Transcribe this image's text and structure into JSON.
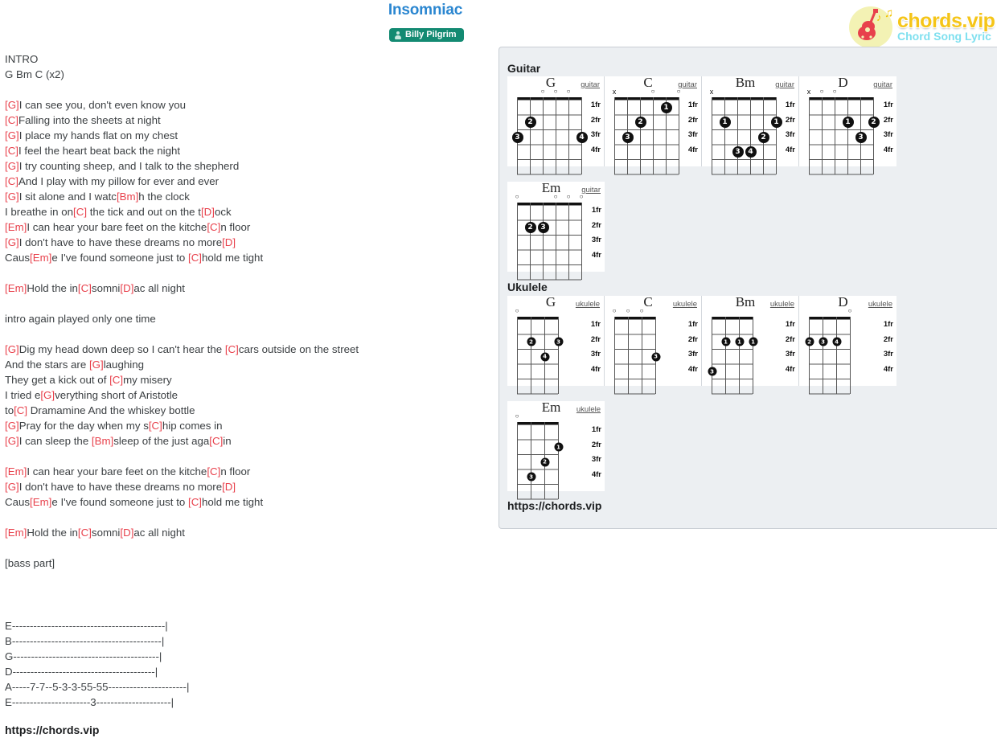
{
  "header": {
    "title": "Insomniac",
    "artist": "Billy Pilgrim",
    "person_icon": "person-icon"
  },
  "logo": {
    "brand": "chords.vip",
    "tagline": "Chord Song Lyric",
    "guitar_icon": "guitar-icon",
    "music_note_icon": "music-note-icon"
  },
  "colors": {
    "title": "#2a86d0",
    "badge_bg": "#138a72",
    "chord": "#e8414c",
    "panel_bg": "#eceff2",
    "logo_yellow": "#f5c518",
    "logo_cyan": "#7fe0ef"
  },
  "lyrics_lines": [
    [
      {
        "t": "INTRO",
        "c": false
      }
    ],
    [
      {
        "t": "G Bm C (x2)",
        "c": false
      }
    ],
    [],
    [
      {
        "t": "[G]",
        "c": true
      },
      {
        "t": "I can see you, don't even know you",
        "c": false
      }
    ],
    [
      {
        "t": "[C]",
        "c": true
      },
      {
        "t": "Falling into the sheets at night",
        "c": false
      }
    ],
    [
      {
        "t": "[G]",
        "c": true
      },
      {
        "t": "I place my hands flat on my chest",
        "c": false
      }
    ],
    [
      {
        "t": "[C]",
        "c": true
      },
      {
        "t": "I feel the heart beat back the night",
        "c": false
      }
    ],
    [
      {
        "t": "[G]",
        "c": true
      },
      {
        "t": "I try counting sheep, and I talk to the shepherd",
        "c": false
      }
    ],
    [
      {
        "t": "[C]",
        "c": true
      },
      {
        "t": "And I play with my pillow for ever and ever",
        "c": false
      }
    ],
    [
      {
        "t": "[G]",
        "c": true
      },
      {
        "t": "I sit alone and I watc",
        "c": false
      },
      {
        "t": "[Bm]",
        "c": true
      },
      {
        "t": "h the clock",
        "c": false
      }
    ],
    [
      {
        "t": "I breathe in on",
        "c": false
      },
      {
        "t": "[C]",
        "c": true
      },
      {
        "t": " the tick and out on the t",
        "c": false
      },
      {
        "t": "[D]",
        "c": true
      },
      {
        "t": "ock",
        "c": false
      }
    ],
    [
      {
        "t": "[Em]",
        "c": true
      },
      {
        "t": "I can hear your bare feet on the kitche",
        "c": false
      },
      {
        "t": "[C]",
        "c": true
      },
      {
        "t": "n floor",
        "c": false
      }
    ],
    [
      {
        "t": "[G]",
        "c": true
      },
      {
        "t": "I don't have to have these dreams no more",
        "c": false
      },
      {
        "t": "[D]",
        "c": true
      }
    ],
    [
      {
        "t": "Caus",
        "c": false
      },
      {
        "t": "[Em]",
        "c": true
      },
      {
        "t": "e I've found someone just to ",
        "c": false
      },
      {
        "t": "[C]",
        "c": true
      },
      {
        "t": "hold me tight",
        "c": false
      }
    ],
    [],
    [
      {
        "t": "[Em]",
        "c": true
      },
      {
        "t": "Hold the in",
        "c": false
      },
      {
        "t": "[C]",
        "c": true
      },
      {
        "t": "somni",
        "c": false
      },
      {
        "t": "[D]",
        "c": true
      },
      {
        "t": "ac all night",
        "c": false
      }
    ],
    [],
    [
      {
        "t": "intro again played only one time",
        "c": false
      }
    ],
    [],
    [
      {
        "t": "[G]",
        "c": true
      },
      {
        "t": "Dig my head down deep so I can't hear the ",
        "c": false
      },
      {
        "t": "[C]",
        "c": true
      },
      {
        "t": "cars outside on the street",
        "c": false
      }
    ],
    [
      {
        "t": "And the stars are ",
        "c": false
      },
      {
        "t": "[G]",
        "c": true
      },
      {
        "t": "laughing",
        "c": false
      }
    ],
    [
      {
        "t": "They get a kick out of ",
        "c": false
      },
      {
        "t": "[C]",
        "c": true
      },
      {
        "t": "my misery",
        "c": false
      }
    ],
    [
      {
        "t": "I tried e",
        "c": false
      },
      {
        "t": "[G]",
        "c": true
      },
      {
        "t": "verything short of Aristotle",
        "c": false
      }
    ],
    [
      {
        "t": "to",
        "c": false
      },
      {
        "t": "[C]",
        "c": true
      },
      {
        "t": " Dramamine And the whiskey bottle",
        "c": false
      }
    ],
    [
      {
        "t": "[G]",
        "c": true
      },
      {
        "t": "Pray for the day when my s",
        "c": false
      },
      {
        "t": "[C]",
        "c": true
      },
      {
        "t": "hip comes in",
        "c": false
      }
    ],
    [
      {
        "t": "[G]",
        "c": true
      },
      {
        "t": "I can sleep the ",
        "c": false
      },
      {
        "t": "[Bm]",
        "c": true
      },
      {
        "t": "sleep of the just aga",
        "c": false
      },
      {
        "t": "[C]",
        "c": true
      },
      {
        "t": "in",
        "c": false
      }
    ],
    [],
    [
      {
        "t": "[Em]",
        "c": true
      },
      {
        "t": "I can hear your bare feet on the kitche",
        "c": false
      },
      {
        "t": "[C]",
        "c": true
      },
      {
        "t": "n floor",
        "c": false
      }
    ],
    [
      {
        "t": "[G]",
        "c": true
      },
      {
        "t": "I don't have to have these dreams no more",
        "c": false
      },
      {
        "t": "[D]",
        "c": true
      }
    ],
    [
      {
        "t": "Caus",
        "c": false
      },
      {
        "t": "[Em]",
        "c": true
      },
      {
        "t": "e I've found someone just to ",
        "c": false
      },
      {
        "t": "[C]",
        "c": true
      },
      {
        "t": "hold me tight",
        "c": false
      }
    ],
    [],
    [
      {
        "t": "[Em]",
        "c": true
      },
      {
        "t": "Hold the in",
        "c": false
      },
      {
        "t": "[C]",
        "c": true
      },
      {
        "t": "somni",
        "c": false
      },
      {
        "t": "[D]",
        "c": true
      },
      {
        "t": "ac all night",
        "c": false
      }
    ],
    [],
    [
      {
        "t": "[bass part]",
        "c": false
      }
    ]
  ],
  "tablature": [
    "E-------------------------------------------|",
    "B------------------------------------------|",
    "G-----------------------------------------|",
    "D----------------------------------------|",
    "A-----7-7--5-3-3-55-55----------------------|",
    "E----------------------3---------------------|"
  ],
  "footer_left": "https://chords.vip",
  "panel": {
    "guitar_label": "Guitar",
    "ukulele_label": "Ukulele",
    "footer": "https://chords.vip",
    "fret_labels": [
      "1fr",
      "2fr",
      "3fr",
      "4fr"
    ]
  },
  "guitar_chords": [
    {
      "name": "G",
      "instrument": "guitar",
      "strings": 6,
      "marks": [
        "",
        "",
        "o",
        "o",
        "o",
        ""
      ],
      "dots": [
        {
          "string": 5,
          "fret": 2,
          "finger": "2"
        },
        {
          "string": 6,
          "fret": 3,
          "finger": "3"
        },
        {
          "string": 1,
          "fret": 3,
          "finger": "4"
        }
      ]
    },
    {
      "name": "C",
      "instrument": "guitar",
      "strings": 6,
      "marks": [
        "x",
        "",
        "",
        "o",
        "",
        "o"
      ],
      "dots": [
        {
          "string": 2,
          "fret": 1,
          "finger": "1"
        },
        {
          "string": 4,
          "fret": 2,
          "finger": "2"
        },
        {
          "string": 5,
          "fret": 3,
          "finger": "3"
        }
      ]
    },
    {
      "name": "Bm",
      "instrument": "guitar",
      "strings": 6,
      "marks": [
        "x",
        "",
        "",
        "",
        "",
        ""
      ],
      "dots": [
        {
          "string": 5,
          "fret": 2,
          "finger": "1"
        },
        {
          "string": 1,
          "fret": 2,
          "finger": "1"
        },
        {
          "string": 2,
          "fret": 3,
          "finger": "2"
        },
        {
          "string": 4,
          "fret": 4,
          "finger": "3"
        },
        {
          "string": 3,
          "fret": 4,
          "finger": "4"
        }
      ]
    },
    {
      "name": "D",
      "instrument": "guitar",
      "strings": 6,
      "marks": [
        "x",
        "o",
        "o",
        "",
        "",
        ""
      ],
      "dots": [
        {
          "string": 3,
          "fret": 2,
          "finger": "1"
        },
        {
          "string": 1,
          "fret": 2,
          "finger": "2"
        },
        {
          "string": 2,
          "fret": 3,
          "finger": "3"
        }
      ]
    },
    {
      "name": "Em",
      "instrument": "guitar",
      "strings": 6,
      "marks": [
        "o",
        "",
        "",
        "o",
        "o",
        "o"
      ],
      "dots": [
        {
          "string": 5,
          "fret": 2,
          "finger": "2"
        },
        {
          "string": 4,
          "fret": 2,
          "finger": "3"
        }
      ]
    }
  ],
  "ukulele_chords": [
    {
      "name": "G",
      "instrument": "ukulele",
      "strings": 4,
      "marks": [
        "o",
        "",
        "",
        ""
      ],
      "dots": [
        {
          "string": 3,
          "fret": 2,
          "finger": "2"
        },
        {
          "string": 1,
          "fret": 2,
          "finger": "3"
        },
        {
          "string": 2,
          "fret": 3,
          "finger": "4"
        }
      ]
    },
    {
      "name": "C",
      "instrument": "ukulele",
      "strings": 4,
      "marks": [
        "o",
        "o",
        "o",
        ""
      ],
      "dots": [
        {
          "string": 1,
          "fret": 3,
          "finger": "3"
        }
      ]
    },
    {
      "name": "Bm",
      "instrument": "ukulele",
      "strings": 4,
      "marks": [
        "",
        "",
        "",
        ""
      ],
      "dots": [
        {
          "string": 3,
          "fret": 2,
          "finger": "1"
        },
        {
          "string": 2,
          "fret": 2,
          "finger": "1"
        },
        {
          "string": 1,
          "fret": 2,
          "finger": "1"
        },
        {
          "string": 4,
          "fret": 4,
          "finger": "3"
        }
      ]
    },
    {
      "name": "D",
      "instrument": "ukulele",
      "strings": 4,
      "marks": [
        "",
        "",
        "",
        "o"
      ],
      "dots": [
        {
          "string": 4,
          "fret": 2,
          "finger": "2"
        },
        {
          "string": 3,
          "fret": 2,
          "finger": "3"
        },
        {
          "string": 2,
          "fret": 2,
          "finger": "4"
        }
      ]
    },
    {
      "name": "Em",
      "instrument": "ukulele",
      "strings": 4,
      "marks": [
        "o",
        "",
        "",
        ""
      ],
      "dots": [
        {
          "string": 1,
          "fret": 2,
          "finger": "1"
        },
        {
          "string": 2,
          "fret": 3,
          "finger": "2"
        },
        {
          "string": 3,
          "fret": 4,
          "finger": "3"
        }
      ]
    }
  ]
}
